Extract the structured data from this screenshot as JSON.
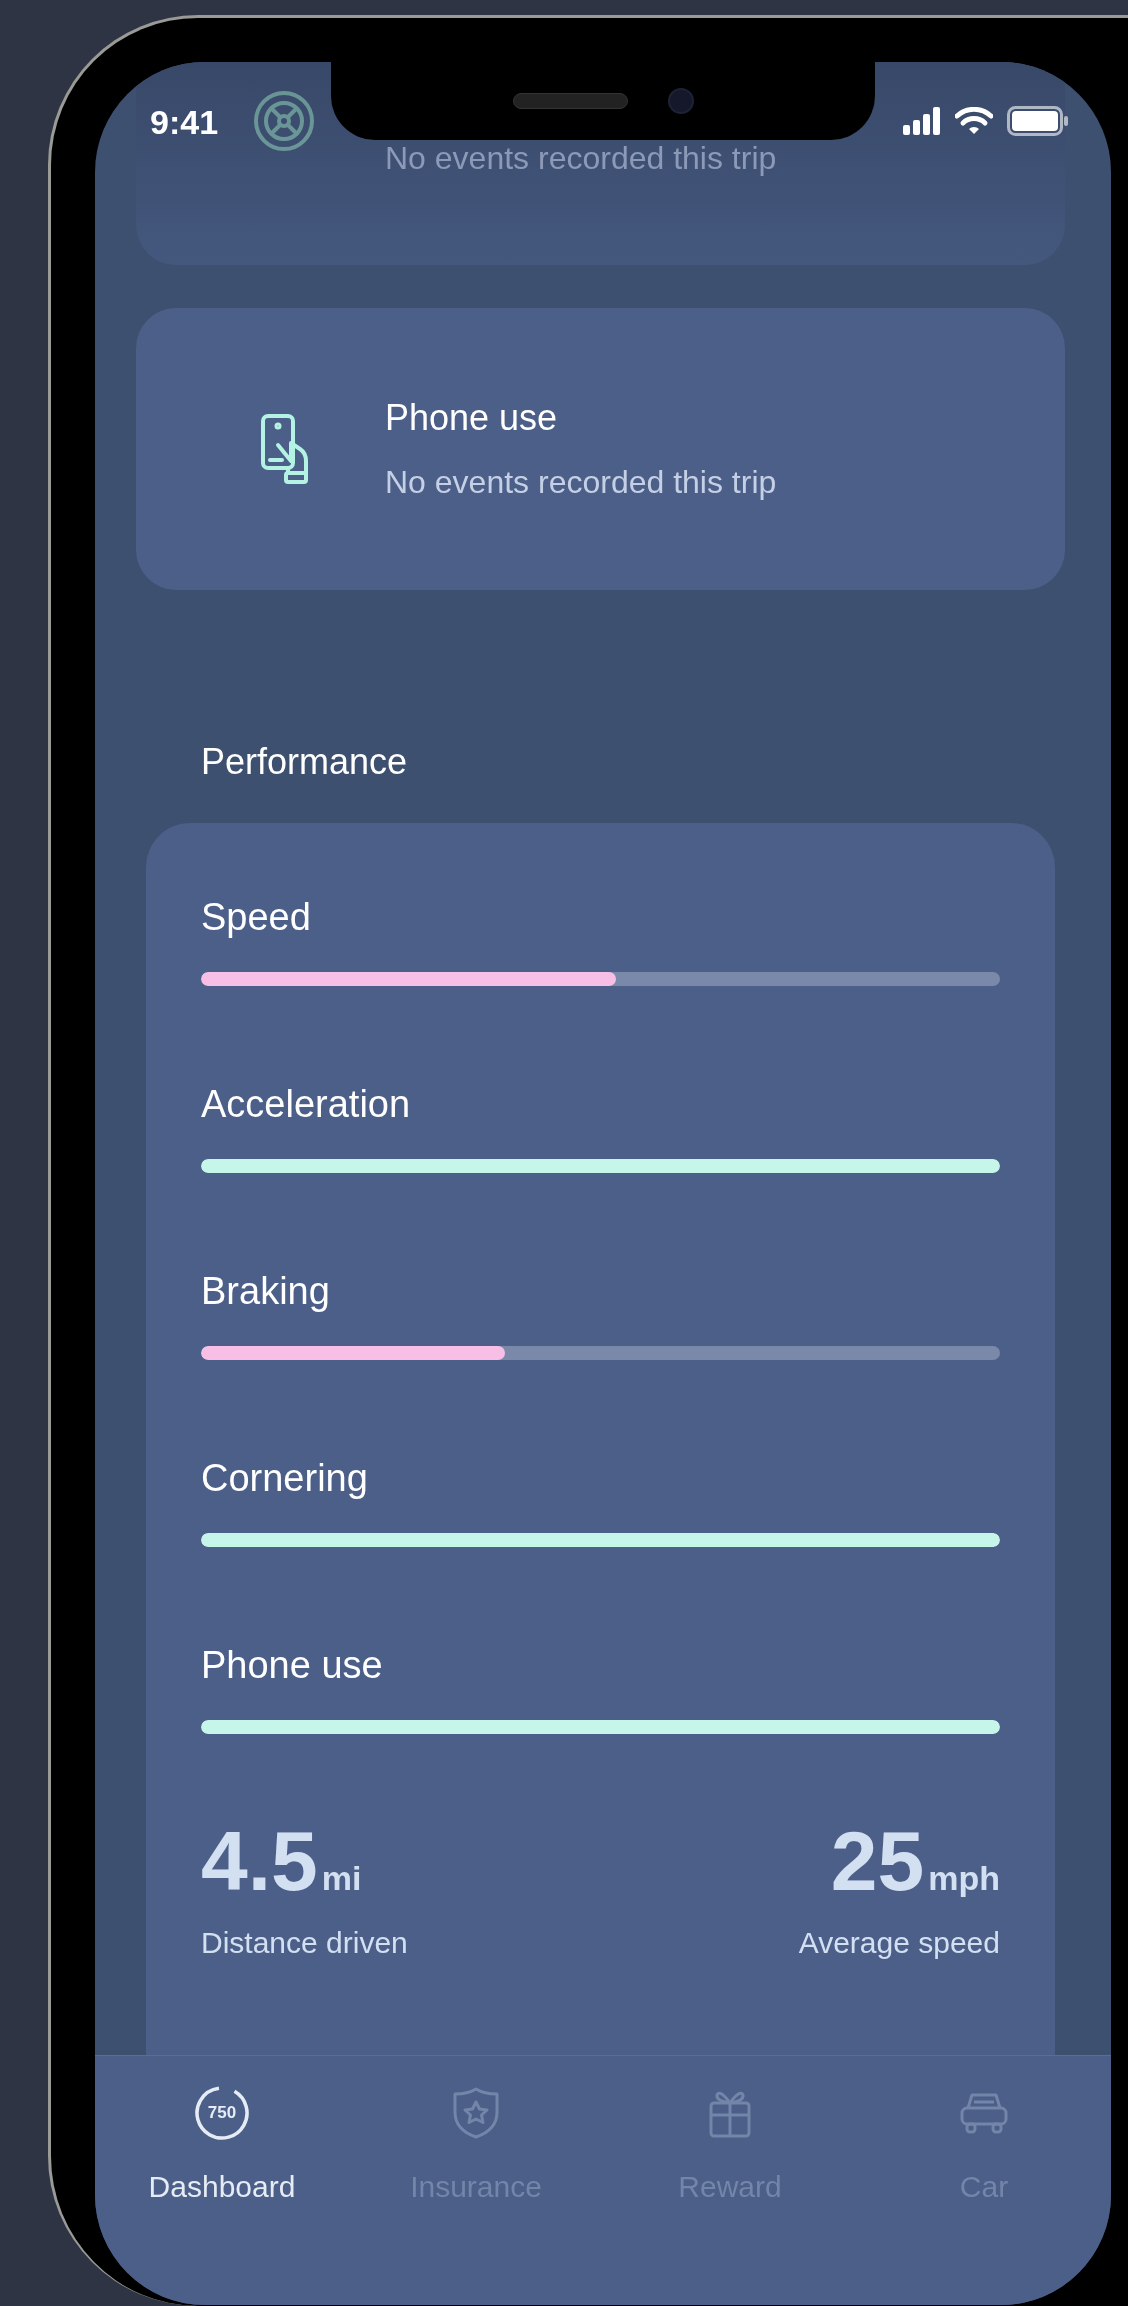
{
  "status_bar": {
    "time": "9:41"
  },
  "event_cards": [
    {
      "kind": "steering",
      "subtitle": "No events recorded this trip"
    },
    {
      "kind": "phone",
      "title": "Phone use",
      "subtitle": "No events recorded this trip"
    }
  ],
  "performance": {
    "heading": "Performance",
    "metrics": [
      {
        "label": "Speed",
        "level": 0.52,
        "color": "#f7bfe5"
      },
      {
        "label": "Acceleration",
        "level": 1,
        "color": "#c6f5ea"
      },
      {
        "label": "Braking",
        "level": 0.38,
        "color": "#f7bfe5"
      },
      {
        "label": "Cornering",
        "level": 1,
        "color": "#c6f5ea"
      },
      {
        "label": "Phone use",
        "level": 1,
        "color": "#c6f5ea"
      }
    ],
    "stats": [
      {
        "value": "4.5",
        "unit": "mi",
        "label": "Distance driven"
      },
      {
        "value": "25",
        "unit": "mph",
        "label": "Average speed"
      }
    ]
  },
  "tab_bar": [
    {
      "kind": "score",
      "badge": "750",
      "label": "Dashboard",
      "selected": true
    },
    {
      "kind": "shield",
      "label": "Insurance",
      "selected": false
    },
    {
      "kind": "gift",
      "label": "Reward",
      "selected": false
    },
    {
      "kind": "car",
      "label": "Car",
      "selected": false
    }
  ]
}
